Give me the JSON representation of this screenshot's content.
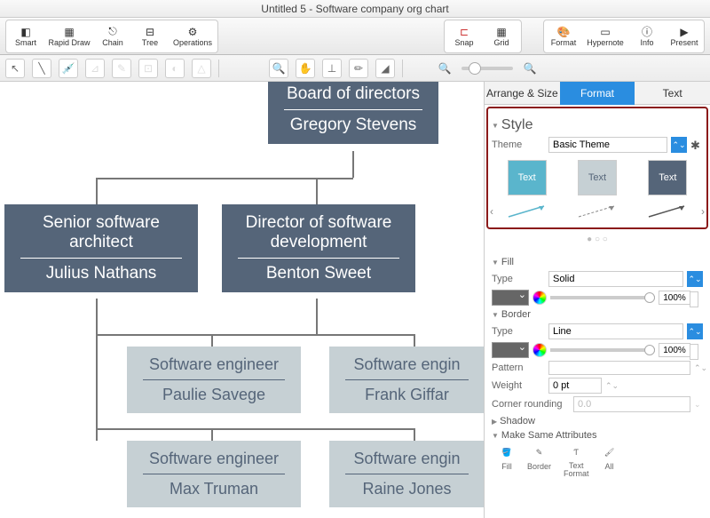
{
  "title": "Untitled 5 - Software company org chart",
  "toolbar": {
    "smart": "Smart",
    "rapid": "Rapid Draw",
    "chain": "Chain",
    "tree": "Tree",
    "ops": "Operations",
    "snap": "Snap",
    "grid": "Grid",
    "format": "Format",
    "hypernote": "Hypernote",
    "info": "Info",
    "present": "Present"
  },
  "tabs": {
    "arrange": "Arrange & Size",
    "format": "Format",
    "text": "Text"
  },
  "style": {
    "head": "Style",
    "theme_label": "Theme",
    "theme_value": "Basic Theme",
    "swatch_text": "Text"
  },
  "fill": {
    "head": "Fill",
    "type_label": "Type",
    "type_value": "Solid",
    "pct": "100%"
  },
  "border": {
    "head": "Border",
    "type_label": "Type",
    "type_value": "Line",
    "pct": "100%",
    "pattern_label": "Pattern",
    "weight_label": "Weight",
    "weight_value": "0 pt",
    "corner_label": "Corner rounding",
    "corner_value": "0.0"
  },
  "shadow": {
    "head": "Shadow"
  },
  "same": {
    "head": "Make Same Attributes",
    "fill": "Fill",
    "border": "Border",
    "textf": "Text\nFormat",
    "all": "All"
  },
  "nodes": {
    "board": {
      "title": "Board of directors",
      "name": "Gregory Stevens"
    },
    "arch": {
      "title": "Senior software architect",
      "name": "Julius Nathans"
    },
    "dir": {
      "title": "Director of software development",
      "name": "Benton Sweet"
    },
    "e1": {
      "title": "Software engineer",
      "name": "Paulie Savege"
    },
    "e2": {
      "title": "Software engin",
      "name": "Frank Giffar"
    },
    "e3": {
      "title": "Software engineer",
      "name": "Max Truman"
    },
    "e4": {
      "title": "Software engin",
      "name": "Raine Jones"
    }
  }
}
